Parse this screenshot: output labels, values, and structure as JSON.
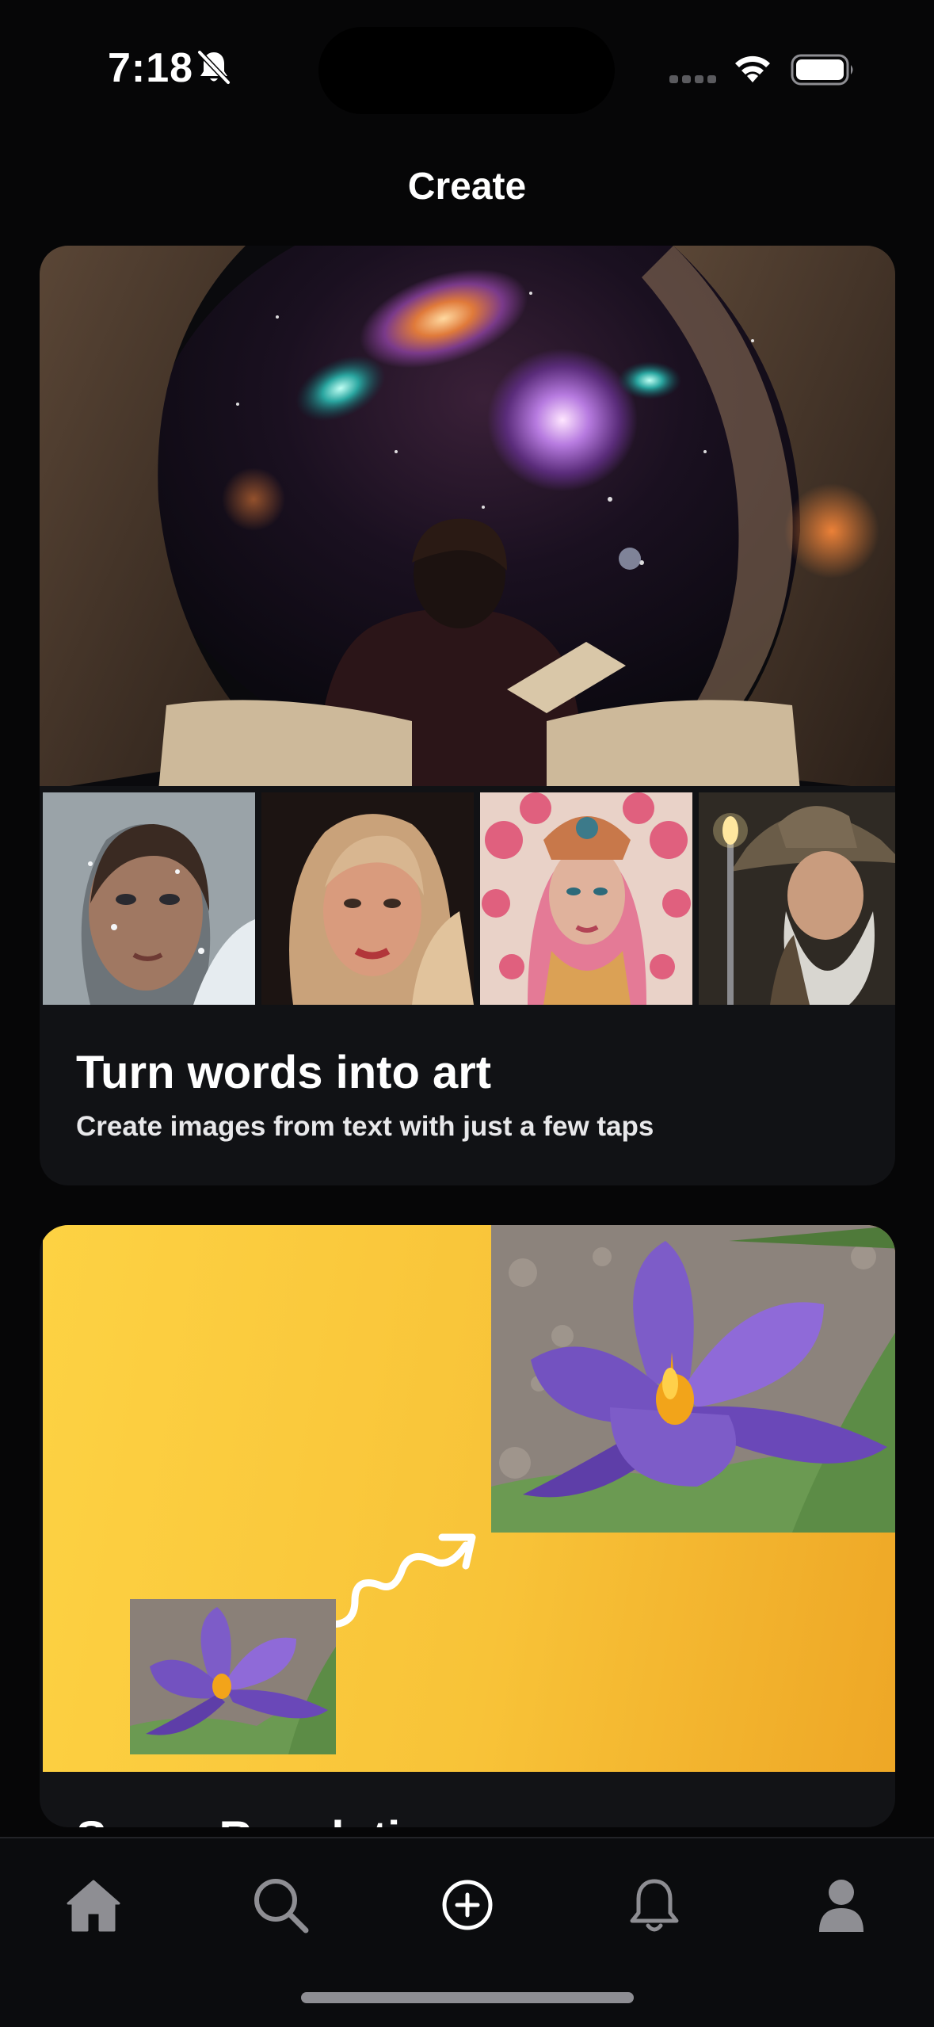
{
  "status_bar": {
    "time": "7:18",
    "icons": [
      "bell-slash-icon",
      "cellular-signal-icon",
      "wifi-icon",
      "battery-icon"
    ]
  },
  "page": {
    "title": "Create"
  },
  "cards": [
    {
      "title": "Turn words into art",
      "subtitle": "Create images from text with just a few taps",
      "images": [
        "cosmic-art-hero",
        "snow-portrait-thumb",
        "blonde-portrait-thumb",
        "floral-headdress-portrait-thumb",
        "wizard-portrait-thumb"
      ]
    },
    {
      "title": "Super Resolution",
      "images": [
        "crocus-flower-large",
        "crocus-flower-small",
        "squiggle-arrow"
      ]
    }
  ],
  "tab_bar": {
    "tabs": [
      "home-icon",
      "search-icon",
      "create-plus-icon",
      "bell-icon",
      "profile-icon"
    ],
    "active_color": "#ffffff",
    "inactive_color": "#8e8e93"
  },
  "colors": {
    "background": "#060607",
    "card": "#111215",
    "super_resolution_gradient": [
      "#fdd243",
      "#eea726"
    ]
  }
}
